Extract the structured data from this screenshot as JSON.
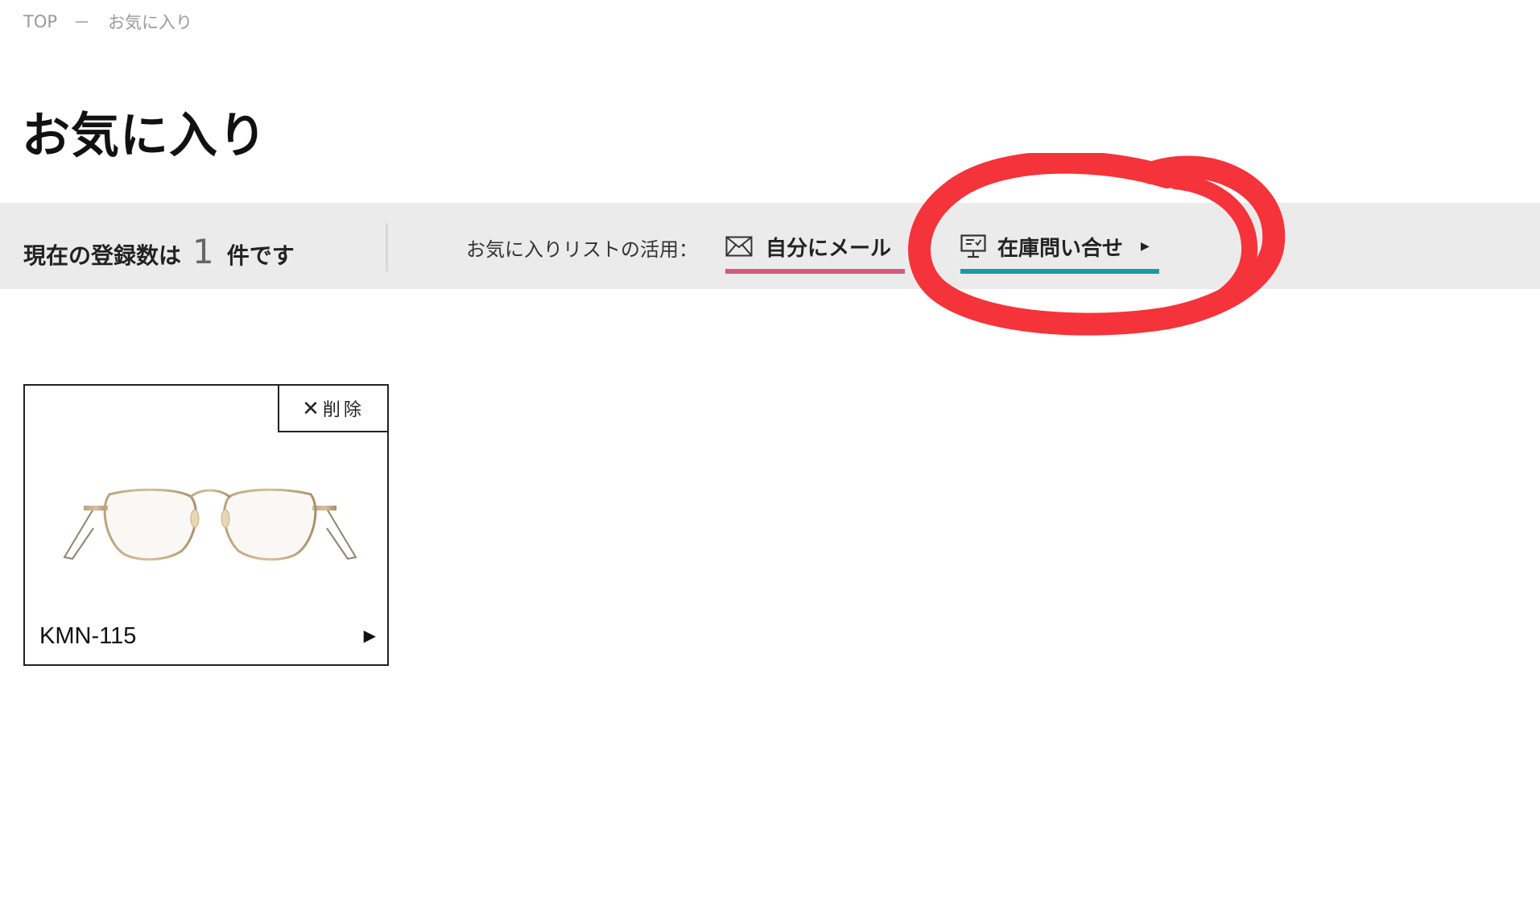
{
  "breadcrumb": {
    "home": "TOP",
    "separator": "－",
    "current": "お気に入り"
  },
  "page_title": "お気に入り",
  "info_bar": {
    "count_prefix": "現在の登録数は",
    "count_value": "1",
    "count_suffix": "件です",
    "use_label": "お気に入りリストの活用：",
    "mail_action": {
      "label": "自分にメール",
      "icon": "envelope-icon",
      "underline_color": "#d9577b"
    },
    "stock_action": {
      "label": "在庫問い合せ",
      "icon": "monitor-chat-icon",
      "arrow": "▶",
      "underline_color": "#1b9a9a"
    }
  },
  "annotation": {
    "color": "#f5333a",
    "shape": "hand-drawn circle around stock inquiry"
  },
  "favorites": [
    {
      "name": "KMN-115",
      "delete_label": "削除",
      "delete_icon": "close-icon",
      "arrow": "▶",
      "image": "gold-rimmed-glasses"
    }
  ]
}
